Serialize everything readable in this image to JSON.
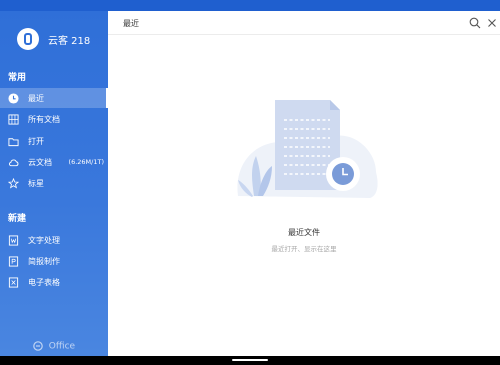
{
  "account": {
    "name": "云客 218"
  },
  "sidebar": {
    "section_common": "常用",
    "items": [
      {
        "label": "最近",
        "icon": "clock-icon",
        "active": true
      },
      {
        "label": "所有文档",
        "icon": "document-grid-icon"
      },
      {
        "label": "打开",
        "icon": "folder-icon"
      },
      {
        "label": "云文档",
        "icon": "cloud-icon",
        "extra": "(6.26M/1T)"
      },
      {
        "label": "标星",
        "icon": "star-icon"
      }
    ],
    "section_new": "新建",
    "new_items": [
      {
        "label": "文字处理",
        "icon": "word-doc-icon"
      },
      {
        "label": "简报制作",
        "icon": "presentation-icon"
      },
      {
        "label": "电子表格",
        "icon": "spreadsheet-icon"
      }
    ],
    "brand": "Office"
  },
  "header": {
    "title": "最近"
  },
  "empty_state": {
    "title": "最近文件",
    "subtitle": "最近打开、显示在这里"
  },
  "colors": {
    "sidebar": "#3a78dc",
    "accent": "#2f6fd8"
  }
}
